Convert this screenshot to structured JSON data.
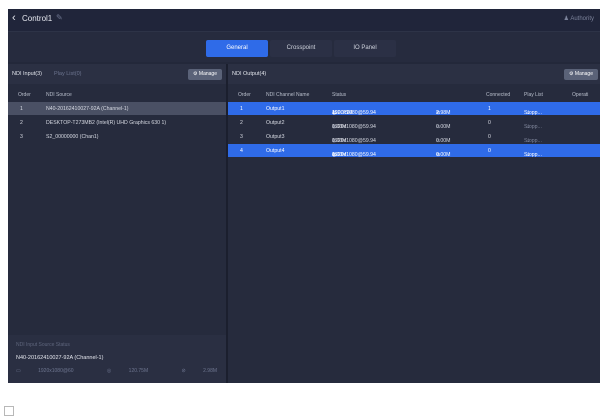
{
  "titlebar": {
    "title": "Control1",
    "user": "Authority"
  },
  "tabs": [
    {
      "label": "General",
      "active": true
    },
    {
      "label": "Crosspoint",
      "active": false
    },
    {
      "label": "IO Panel",
      "active": false
    }
  ],
  "input_panel": {
    "title": "NDI Input(3)",
    "secondary_tab": "Play List(0)",
    "manage_label": "Manage",
    "columns": [
      "Order",
      "NDI Source"
    ],
    "rows": [
      {
        "order": "1",
        "source": "N40-20162410027-92A (Channel-1)"
      },
      {
        "order": "2",
        "source": "DESKTOP-T273MB2 (Intel(R) UHD Graphics 630 1)"
      },
      {
        "order": "3",
        "source": "S2_00000000 (Chan1)"
      }
    ]
  },
  "input_status": {
    "label": "NDI Input Source Status",
    "name": "N40-20162410027-92A (Channel-1)",
    "resolution": "1920x1080@60",
    "bitrate": "120.75M",
    "bandwidth": "2.98M"
  },
  "output_panel": {
    "title": "NDI Output(4)",
    "manage_label": "Manage",
    "columns": [
      "Order",
      "NDI Channel Name",
      "Status",
      "Connected",
      "Play List",
      "Operati"
    ],
    "rows": [
      {
        "order": "1",
        "name": "Output1",
        "format": "1920x1080@59.94",
        "bitrate": "120.75M",
        "bandwidth": "2.98M",
        "connected": "1",
        "playlist": "Stopp..."
      },
      {
        "order": "2",
        "name": "Output2",
        "format": "1920x1080@59.94",
        "bitrate": "0.00M",
        "bandwidth": "0.00M",
        "connected": "0",
        "playlist": "Stopp..."
      },
      {
        "order": "3",
        "name": "Output3",
        "format": "1920x1080@59.94",
        "bitrate": "0.00M",
        "bandwidth": "0.00M",
        "connected": "0",
        "playlist": "Stopp..."
      },
      {
        "order": "4",
        "name": "Output4",
        "format": "1920x1080@59.94",
        "bitrate": "0.00M",
        "bandwidth": "0.00M",
        "connected": "0",
        "playlist": "Stopp..."
      }
    ]
  },
  "colors": {
    "accent": "#2f6be8",
    "background": "#23283a",
    "panel": "#262b3d"
  }
}
